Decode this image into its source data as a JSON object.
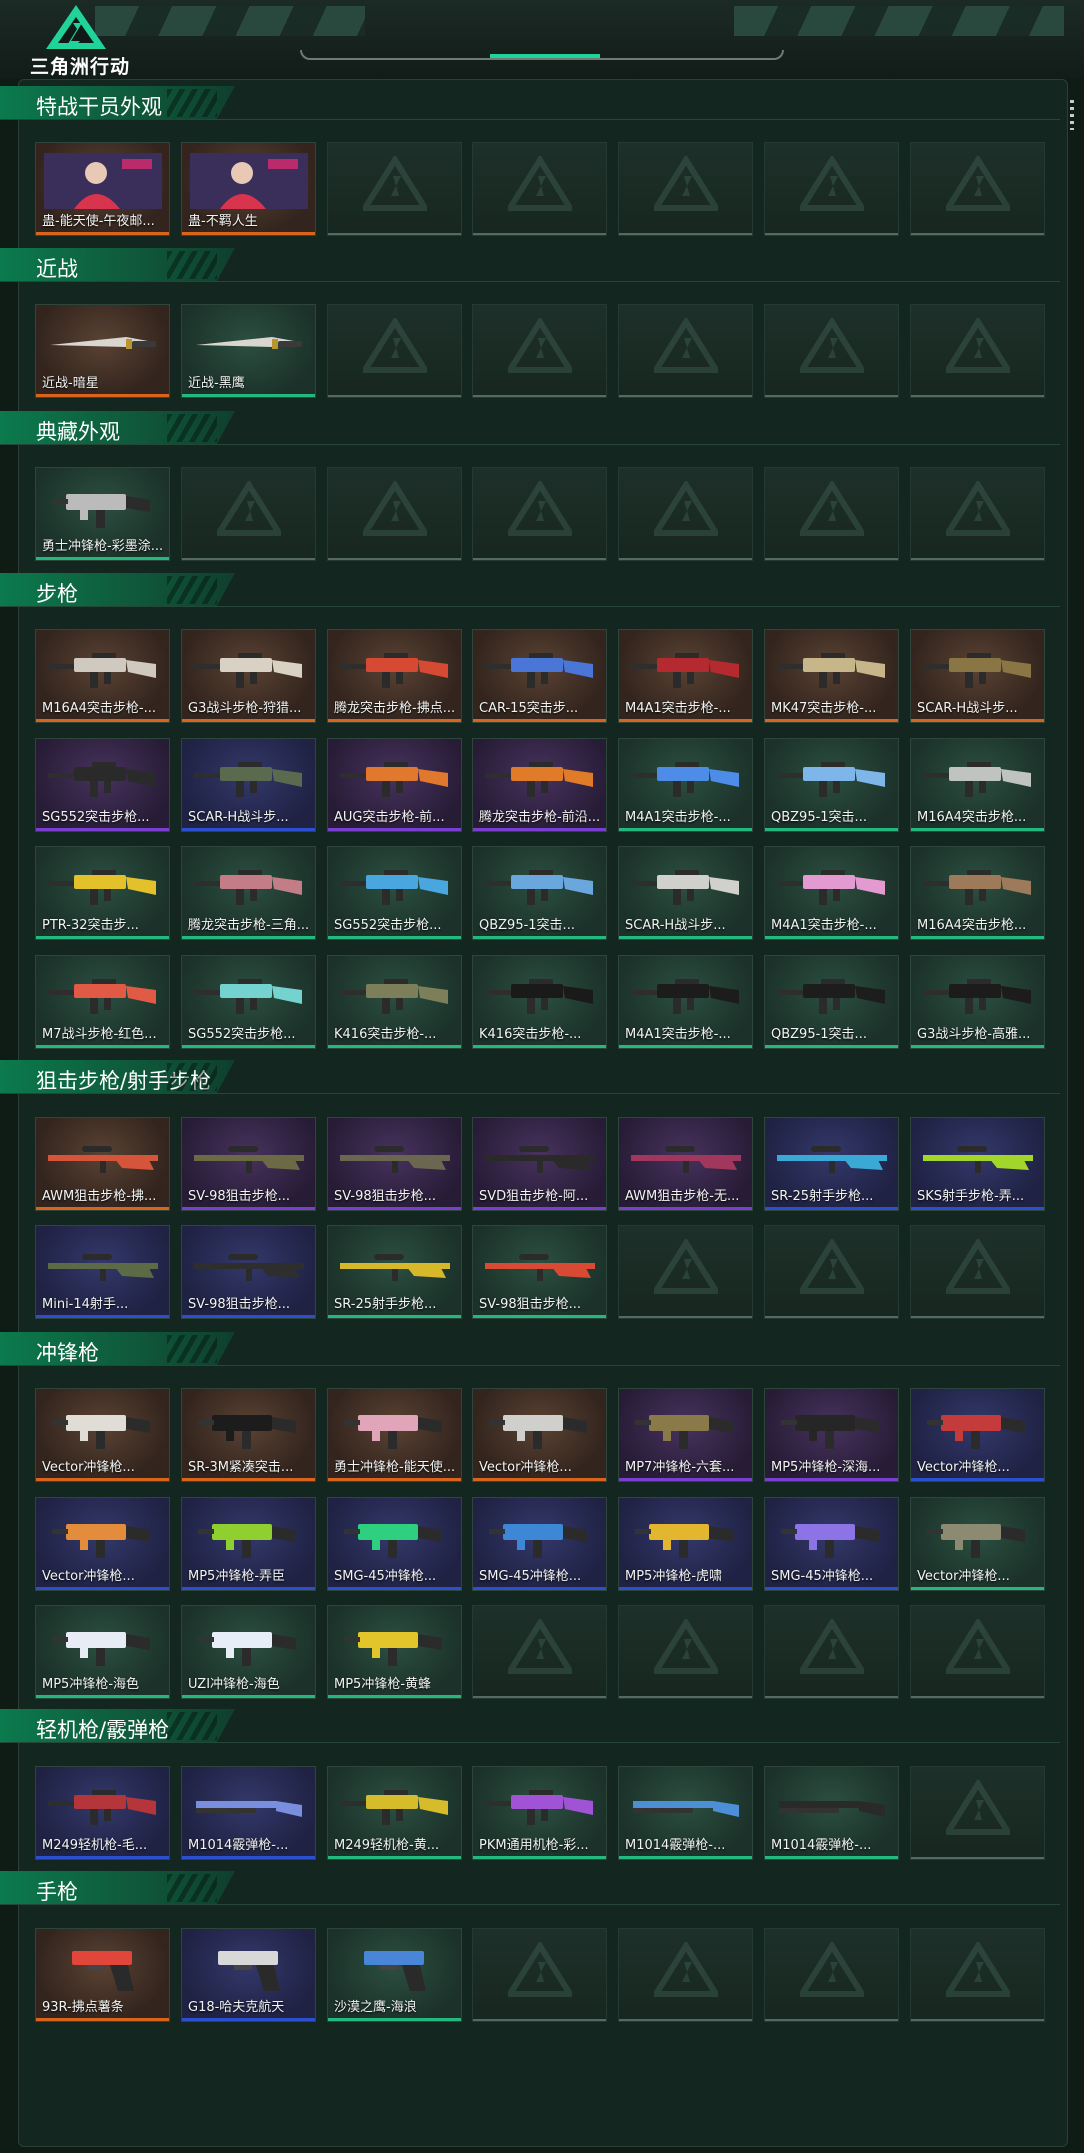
{
  "app": {
    "logo_text": "三角洲行动"
  },
  "colors": {
    "orange": "#d8651b",
    "blue": "#2c4fcf",
    "green": "#21b97d",
    "purple": "#7a3fd1",
    "header": "#0b7a4d"
  },
  "sections": [
    {
      "title": "特战干员外观",
      "rows": [
        [
          {
            "label": "蛊-能天使-午夜邮...",
            "rarity": "r-orange",
            "kind": "operator"
          },
          {
            "label": "蛊-不羁人生",
            "rarity": "r-orange",
            "kind": "operator"
          },
          null,
          null,
          null,
          null,
          null
        ]
      ]
    },
    {
      "title": "近战",
      "rows": [
        [
          {
            "label": "近战-暗星",
            "rarity": "r-orange",
            "kind": "knife"
          },
          {
            "label": "近战-黑鹰",
            "rarity": "r-green",
            "kind": "knife"
          },
          null,
          null,
          null,
          null,
          null
        ]
      ]
    },
    {
      "title": "典藏外观",
      "rows": [
        [
          {
            "label": "勇士冲锋枪-彩墨涂...",
            "rarity": "r-green",
            "kind": "smg"
          },
          null,
          null,
          null,
          null,
          null,
          null
        ]
      ]
    },
    {
      "title": "步枪",
      "rows": [
        [
          {
            "label": "M16A4突击步枪-...",
            "rarity": "r-orange",
            "kind": "rifle",
            "gun": "#cfc9bf"
          },
          {
            "label": "G3战斗步枪-狩猎...",
            "rarity": "r-orange",
            "kind": "rifle",
            "gun": "#d9d1c4"
          },
          {
            "label": "腾龙突击步枪-拂点...",
            "rarity": "r-orange",
            "kind": "rifle",
            "gun": "#d64a33"
          },
          {
            "label": "CAR-15突击步...",
            "rarity": "r-orange",
            "kind": "rifle",
            "gun": "#4a76d8"
          },
          {
            "label": "M4A1突击步枪-...",
            "rarity": "r-orange",
            "kind": "rifle",
            "gun": "#b52a2f"
          },
          {
            "label": "MK47突击步枪-...",
            "rarity": "r-orange",
            "kind": "rifle",
            "gun": "#c7b68a"
          },
          {
            "label": "SCAR-H战斗步...",
            "rarity": "r-orange",
            "kind": "rifle",
            "gun": "#8a7544"
          }
        ],
        [
          {
            "label": "SG552突击步枪...",
            "rarity": "r-purple",
            "kind": "rifle",
            "gun": "#2a2a2a"
          },
          {
            "label": "SCAR-H战斗步...",
            "rarity": "r-blue",
            "kind": "rifle",
            "gun": "#5a6a4e"
          },
          {
            "label": "AUG突击步枪-前...",
            "rarity": "r-purple",
            "kind": "rifle",
            "gun": "#e0782d"
          },
          {
            "label": "腾龙突击步枪-前沿...",
            "rarity": "r-purple",
            "kind": "rifle",
            "gun": "#e07b2a"
          },
          {
            "label": "M4A1突击步枪-...",
            "rarity": "r-green",
            "kind": "rifle",
            "gun": "#4d8de8"
          },
          {
            "label": "QBZ95-1突击...",
            "rarity": "r-green",
            "kind": "rifle",
            "gun": "#7fb6ea"
          },
          {
            "label": "M16A4突击步枪...",
            "rarity": "r-green",
            "kind": "rifle",
            "gun": "#bfc4c0"
          }
        ],
        [
          {
            "label": "PTR-32突击步...",
            "rarity": "r-green",
            "kind": "rifle",
            "gun": "#e2c12a"
          },
          {
            "label": "腾龙突击步枪-三角...",
            "rarity": "r-green",
            "kind": "rifle",
            "gun": "#c27d86"
          },
          {
            "label": "SG552突击步枪...",
            "rarity": "r-green",
            "kind": "rifle",
            "gun": "#4aa6df"
          },
          {
            "label": "QBZ95-1突击...",
            "rarity": "r-green",
            "kind": "rifle",
            "gun": "#6aa7dc"
          },
          {
            "label": "SCAR-H战斗步...",
            "rarity": "r-green",
            "kind": "rifle",
            "gun": "#d0d0cc"
          },
          {
            "label": "M4A1突击步枪-...",
            "rarity": "r-green",
            "kind": "rifle",
            "gun": "#e39ad0"
          },
          {
            "label": "M16A4突击步枪...",
            "rarity": "r-green",
            "kind": "rifle",
            "gun": "#9c7a5a"
          }
        ],
        [
          {
            "label": "M7战斗步枪-红色...",
            "rarity": "r-green",
            "kind": "rifle",
            "gun": "#e05a45"
          },
          {
            "label": "SG552突击步枪...",
            "rarity": "r-green",
            "kind": "rifle",
            "gun": "#74d2cf"
          },
          {
            "label": "K416突击步枪-...",
            "rarity": "r-green",
            "kind": "rifle",
            "gun": "#7d7f5a"
          },
          {
            "label": "K416突击步枪-...",
            "rarity": "r-green",
            "kind": "rifle",
            "gun": "#1a1a1a"
          },
          {
            "label": "M4A1突击步枪-...",
            "rarity": "r-green",
            "kind": "rifle",
            "gun": "#1c1c1c"
          },
          {
            "label": "QBZ95-1突击...",
            "rarity": "r-green",
            "kind": "rifle",
            "gun": "#1d1d1d"
          },
          {
            "label": "G3战斗步枪-高雅...",
            "rarity": "r-green",
            "kind": "rifle",
            "gun": "#1c1c1c"
          }
        ]
      ]
    },
    {
      "title": "狙击步枪/射手步枪",
      "rows": [
        [
          {
            "label": "AWM狙击步枪-拂...",
            "rarity": "r-orange",
            "kind": "sniper",
            "gun": "#d5553a"
          },
          {
            "label": "SV-98狙击步枪...",
            "rarity": "r-purple",
            "kind": "sniper",
            "gun": "#6b6a45"
          },
          {
            "label": "SV-98狙击步枪...",
            "rarity": "r-purple",
            "kind": "sniper",
            "gun": "#6a6650"
          },
          {
            "label": "SVD狙击步枪-阿...",
            "rarity": "r-purple",
            "kind": "sniper",
            "gun": "#2a2a2a"
          },
          {
            "label": "AWM狙击步枪-无...",
            "rarity": "r-purple",
            "kind": "sniper",
            "gun": "#a2375e"
          },
          {
            "label": "SR-25射手步枪...",
            "rarity": "r-blue",
            "kind": "sniper",
            "gun": "#3ba9d6"
          },
          {
            "label": "SKS射手步枪-弄...",
            "rarity": "r-blue",
            "kind": "sniper",
            "gun": "#a3d62a"
          }
        ],
        [
          {
            "label": "Mini-14射手...",
            "rarity": "r-blue",
            "kind": "sniper",
            "gun": "#5c6a45"
          },
          {
            "label": "SV-98狙击步枪...",
            "rarity": "r-blue",
            "kind": "sniper",
            "gun": "#2e2e2e"
          },
          {
            "label": "SR-25射手步枪...",
            "rarity": "r-green",
            "kind": "sniper",
            "gun": "#d7b82a"
          },
          {
            "label": "SV-98狙击步枪...",
            "rarity": "r-green",
            "kind": "sniper",
            "gun": "#d94a35"
          },
          null,
          null,
          null
        ]
      ]
    },
    {
      "title": "冲锋枪",
      "rows": [
        [
          {
            "label": "Vector冲锋枪...",
            "rarity": "r-orange",
            "kind": "smg",
            "gun": "#e0ddd6"
          },
          {
            "label": "SR-3M紧凑突击...",
            "rarity": "r-orange",
            "kind": "smg",
            "gun": "#1c1c1c"
          },
          {
            "label": "勇士冲锋枪-能天使...",
            "rarity": "r-orange",
            "kind": "smg",
            "gun": "#e0a5b8"
          },
          {
            "label": "Vector冲锋枪...",
            "rarity": "r-orange",
            "kind": "smg",
            "gun": "#cfd0cc"
          },
          {
            "label": "MP7冲锋枪-六套...",
            "rarity": "r-purple",
            "kind": "smg",
            "gun": "#8a7a4a"
          },
          {
            "label": "MP5冲锋枪-深海...",
            "rarity": "r-purple",
            "kind": "smg",
            "gun": "#262626"
          },
          {
            "label": "Vector冲锋枪...",
            "rarity": "r-blue",
            "kind": "smg",
            "gun": "#c43b3b"
          }
        ],
        [
          {
            "label": "Vector冲锋枪...",
            "rarity": "r-blue",
            "kind": "smg",
            "gun": "#e38c3b"
          },
          {
            "label": "MP5冲锋枪-弄臣",
            "rarity": "r-blue",
            "kind": "smg",
            "gun": "#8fd030"
          },
          {
            "label": "SMG-45冲锋枪...",
            "rarity": "r-blue",
            "kind": "smg",
            "gun": "#2ed07f"
          },
          {
            "label": "SMG-45冲锋枪...",
            "rarity": "r-blue",
            "kind": "smg",
            "gun": "#3e87d6"
          },
          {
            "label": "MP5冲锋枪-虎啸",
            "rarity": "r-blue",
            "kind": "smg",
            "gun": "#e2b62e"
          },
          {
            "label": "SMG-45冲锋枪...",
            "rarity": "r-blue",
            "kind": "smg",
            "gun": "#8c74e6"
          },
          {
            "label": "Vector冲锋枪...",
            "rarity": "r-green",
            "kind": "smg",
            "gun": "#8d8a72"
          }
        ],
        [
          {
            "label": "MP5冲锋枪-海色",
            "rarity": "r-green",
            "kind": "smg",
            "gun": "#e8edf5"
          },
          {
            "label": "UZI冲锋枪-海色",
            "rarity": "r-green",
            "kind": "smg",
            "gun": "#e8eef7"
          },
          {
            "label": "MP5冲锋枪-黄蜂",
            "rarity": "r-green",
            "kind": "smg",
            "gun": "#e2c52a"
          },
          null,
          null,
          null,
          null
        ]
      ]
    },
    {
      "title": "轻机枪/霰弹枪",
      "rows": [
        [
          {
            "label": "M249轻机枪-毛...",
            "rarity": "r-blue",
            "kind": "rifle",
            "gun": "#b4363a"
          },
          {
            "label": "M1014霰弹枪-...",
            "rarity": "r-blue",
            "kind": "shotgun",
            "gun": "#7a8ee0"
          },
          {
            "label": "M249轻机枪-黄...",
            "rarity": "r-green",
            "kind": "rifle",
            "gun": "#d6bb2a"
          },
          {
            "label": "PKM通用机枪-彩...",
            "rarity": "r-green",
            "kind": "rifle",
            "gun": "#a153d6"
          },
          {
            "label": "M1014霰弹枪-...",
            "rarity": "r-green",
            "kind": "shotgun",
            "gun": "#4c8fd6"
          },
          {
            "label": "M1014霰弹枪-...",
            "rarity": "r-green",
            "kind": "shotgun",
            "gun": "#2a2a2a"
          },
          null
        ]
      ]
    },
    {
      "title": "手枪",
      "rows": [
        [
          {
            "label": "93R-拂点薯条",
            "rarity": "r-orange",
            "kind": "pistol",
            "gun": "#e0463a"
          },
          {
            "label": "G18-哈夫克航天",
            "rarity": "r-blue",
            "kind": "pistol",
            "gun": "#d8d8d8"
          },
          {
            "label": "沙漠之鹰-海浪",
            "rarity": "r-green",
            "kind": "pistol",
            "gun": "#4a86d8"
          },
          null,
          null,
          null,
          null
        ]
      ]
    }
  ]
}
